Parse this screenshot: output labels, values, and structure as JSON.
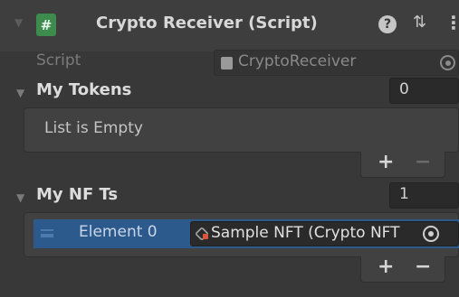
{
  "header": {
    "fold_icon": "triangle-down",
    "script_icon": "#",
    "title": "Crypto Receiver (Script)",
    "help_icon": "?",
    "preset_icon": "⇅",
    "menu_icon": "⋮"
  },
  "script_row": {
    "label": "Script",
    "value": "CryptoReceiver"
  },
  "my_tokens": {
    "label": "My Tokens",
    "count": "0",
    "empty_text": "List is Empty",
    "plus": "+",
    "minus": "−"
  },
  "my_nfts": {
    "label": "My NF Ts",
    "count": "1",
    "elements": [
      {
        "label": "Element 0",
        "value": "Sample NFT (Crypto NFT"
      }
    ],
    "plus": "+",
    "minus": "−"
  },
  "colors": {
    "background": "#383838",
    "header": "#3e3e3e",
    "script_icon": "#3d8c4e",
    "selection": "#2d5a8d"
  }
}
